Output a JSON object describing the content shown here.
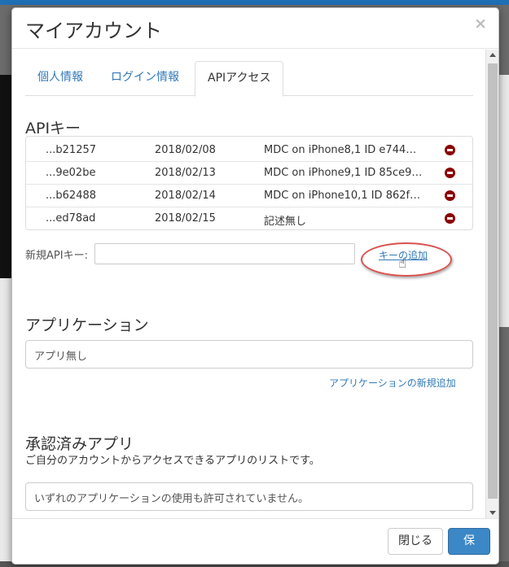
{
  "modal": {
    "title": "マイアカウント",
    "close_glyph": "×"
  },
  "tabs": [
    {
      "label": "個人情報",
      "active": false
    },
    {
      "label": "ログイン情報",
      "active": false
    },
    {
      "label": "APIアクセス",
      "active": true
    }
  ],
  "api_keys": {
    "heading": "APIキー",
    "rows": [
      {
        "key": "...b21257",
        "date": "2018/02/08",
        "description": "MDC on iPhone8,1 ID e744…"
      },
      {
        "key": "...9e02be",
        "date": "2018/02/13",
        "description": "MDC on iPhone9,1 ID 85ce9…"
      },
      {
        "key": "...b62488",
        "date": "2018/02/14",
        "description": "MDC on iPhone10,1 ID 862f…"
      },
      {
        "key": "...ed78ad",
        "date": "2018/02/15",
        "description": "記述無し"
      }
    ],
    "new_key_label": "新規APIキー:",
    "new_key_value": "",
    "add_key_link": "キーの追加"
  },
  "applications": {
    "heading": "アプリケーション",
    "empty_text": "アプリ無し",
    "new_app_link": "アプリケーションの新規追加"
  },
  "approved_apps": {
    "heading": "承認済みアプリ",
    "description": "ご自分のアカウントからアクセスできるアプリのリストです。",
    "empty_text": "いずれのアプリケーションの使用も許可されていません。"
  },
  "footer": {
    "close_label": "閉じる",
    "save_label": "保存"
  },
  "colors": {
    "link": "#337ab7",
    "primary_button": "#3c87c6",
    "delete_icon": "#8b0000",
    "annotation": "#d9534f"
  },
  "icons": {
    "delete": "minus-circle-icon",
    "cursor": "hand-pointer-icon"
  }
}
